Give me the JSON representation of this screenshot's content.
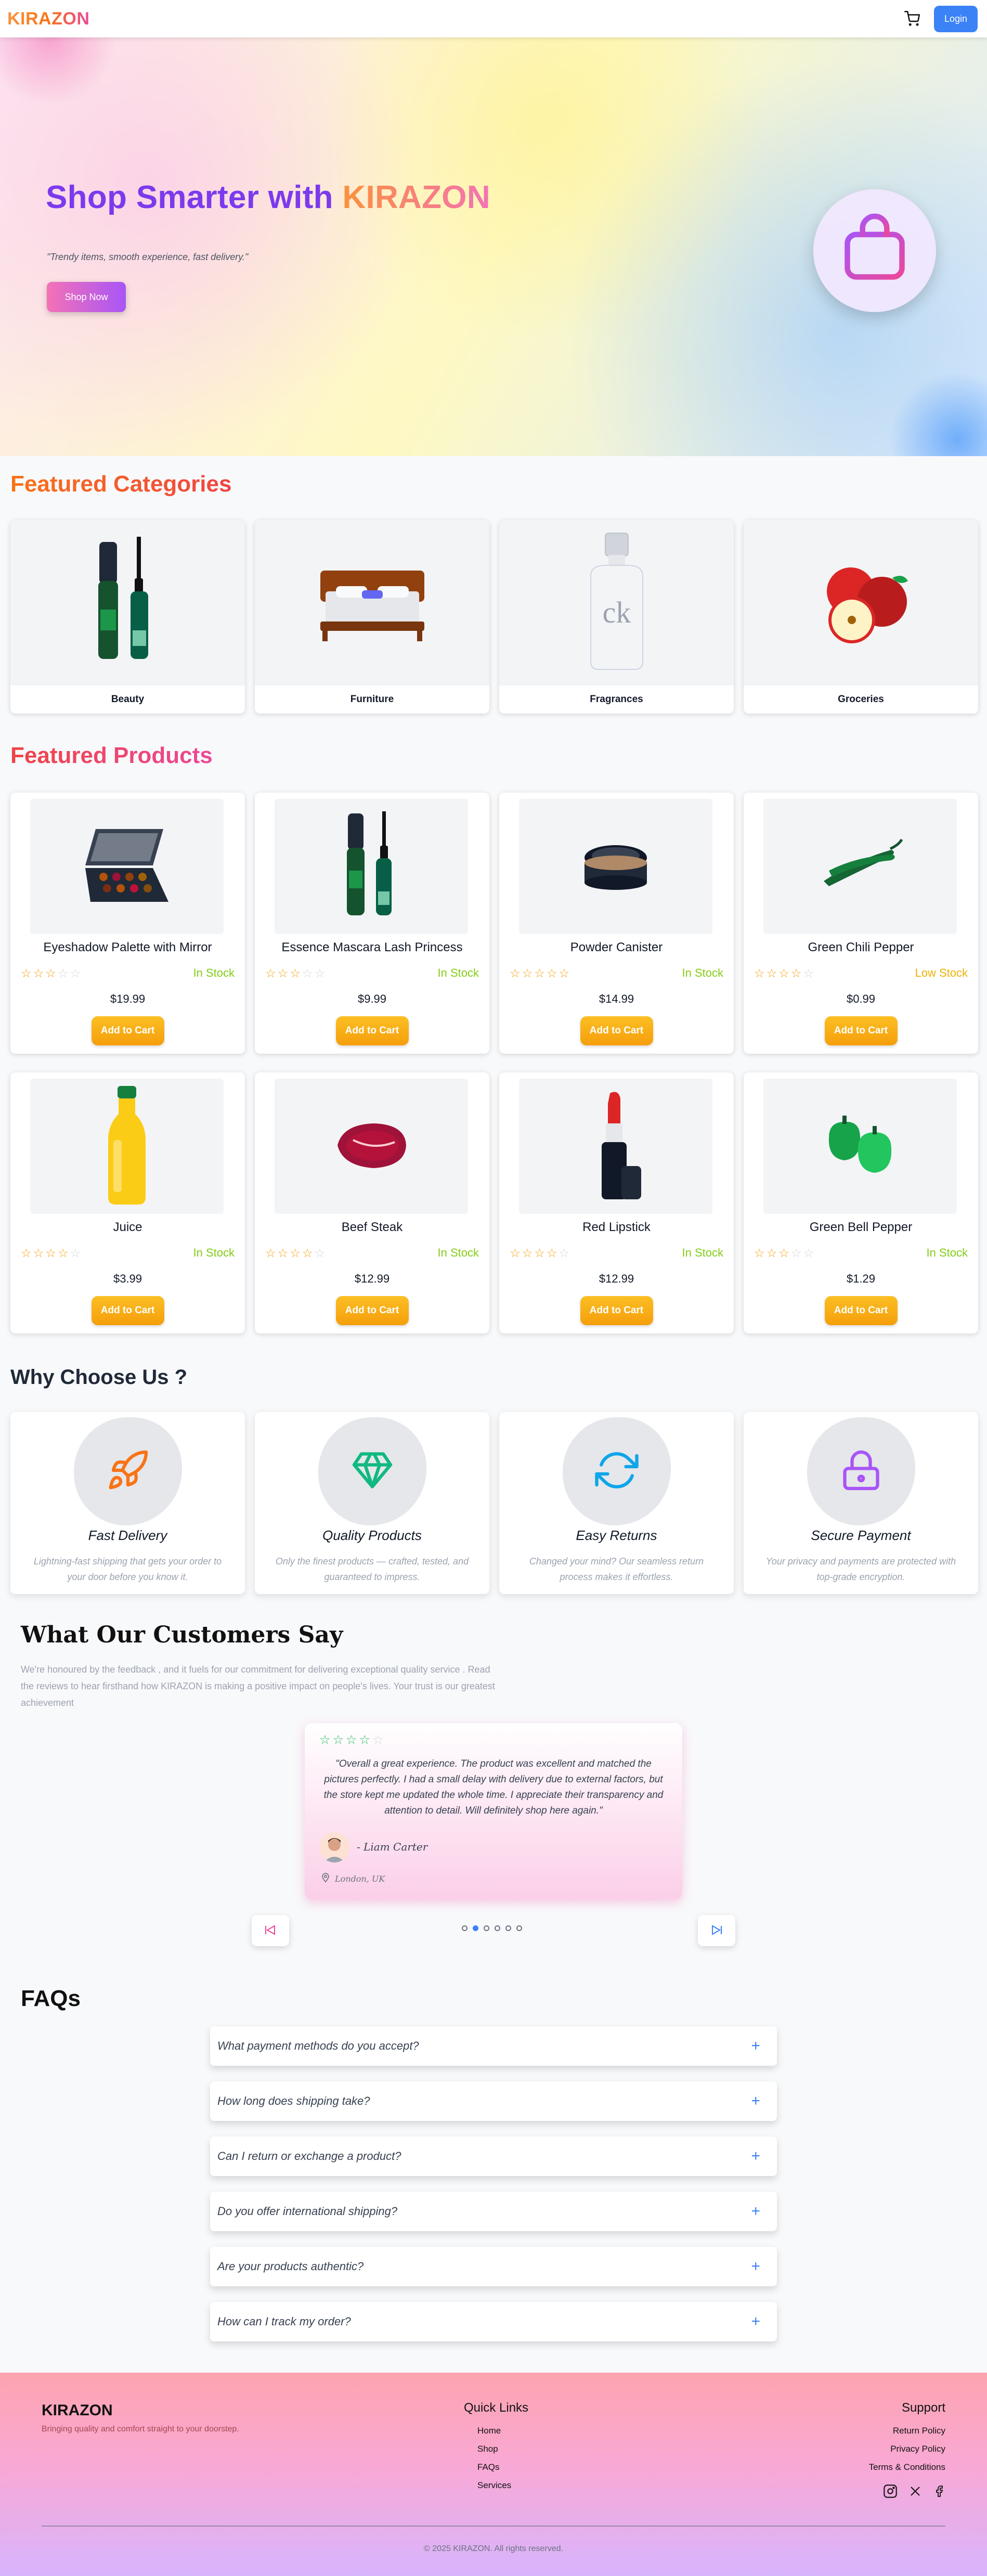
{
  "nav": {
    "logo": "KIRAZON",
    "login_label": "Login"
  },
  "hero": {
    "title_prefix": "Shop Smarter with ",
    "title_brand": "KIRAZON",
    "subtitle": "\"Trendy items, smooth experience, fast delivery.\"",
    "cta_label": "Shop Now"
  },
  "categories": {
    "title": "Featured Categories",
    "items": [
      {
        "label": "Beauty",
        "icon": "mascara-icon"
      },
      {
        "label": "Furniture",
        "icon": "bed-icon"
      },
      {
        "label": "Fragrances",
        "icon": "perfume-bottle-icon"
      },
      {
        "label": "Groceries",
        "icon": "apples-icon"
      }
    ]
  },
  "products": {
    "title": "Featured Products",
    "add_label": "Add to Cart",
    "items": [
      {
        "name": "Eyeshadow Palette with Mirror",
        "rating": 3,
        "stock": "In Stock",
        "price": "$19.99",
        "icon": "eyeshadow-palette-icon"
      },
      {
        "name": "Essence Mascara Lash Princess",
        "rating": 3,
        "stock": "In Stock",
        "price": "$9.99",
        "icon": "mascara-icon"
      },
      {
        "name": "Powder Canister",
        "rating": 5,
        "stock": "In Stock",
        "price": "$14.99",
        "icon": "powder-canister-icon"
      },
      {
        "name": "Green Chili Pepper",
        "rating": 4,
        "stock": "Low Stock",
        "price": "$0.99",
        "icon": "chili-pepper-icon"
      },
      {
        "name": "Juice",
        "rating": 4,
        "stock": "In Stock",
        "price": "$3.99",
        "icon": "juice-bottle-icon"
      },
      {
        "name": "Beef Steak",
        "rating": 4,
        "stock": "In Stock",
        "price": "$12.99",
        "icon": "steak-icon"
      },
      {
        "name": "Red Lipstick",
        "rating": 4,
        "stock": "In Stock",
        "price": "$12.99",
        "icon": "lipstick-icon"
      },
      {
        "name": "Green Bell Pepper",
        "rating": 3,
        "stock": "In Stock",
        "price": "$1.29",
        "icon": "bell-pepper-icon"
      }
    ]
  },
  "why": {
    "title": "Why Choose Us ?",
    "items": [
      {
        "name": "Fast Delivery",
        "desc": "Lightning-fast shipping that gets your order to your door before you know it.",
        "icon": "rocket-icon",
        "color": "#f97316"
      },
      {
        "name": "Quality Products",
        "desc": "Only the finest products — crafted, tested, and guaranteed to impress.",
        "icon": "gem-icon",
        "color": "#10b981"
      },
      {
        "name": "Easy Returns",
        "desc": "Changed your mind? Our seamless return process makes it effortless.",
        "icon": "refresh-icon",
        "color": "#0ea5e9"
      },
      {
        "name": "Secure Payment",
        "desc": "Your privacy and payments are protected with top-grade encryption.",
        "icon": "lock-icon",
        "color": "#a855f7"
      }
    ]
  },
  "testimonials": {
    "title": "What Our Customers Say",
    "intro": "We're honoured by the feedback , and it fuels for our commitment for delivering exceptional quality service . Read the reviews to hear firsthand how KIRAZON is making a positive impact on people's lives. Your trust is our greatest achievement",
    "rating": 4,
    "quote": "\"Overall a great experience. The product was excellent and matched the pictures perfectly. I had a small delay with delivery due to external factors, but the store kept me updated the whole time. I appreciate their transparency and attention to detail. Will definitely shop here again.\"",
    "author": "- Liam Carter",
    "location": "London, UK",
    "active_slide": 2,
    "slide_count": 6
  },
  "faq": {
    "title": "FAQs",
    "items": [
      "What payment methods do you accept?",
      "How long does shipping take?",
      "Can I return or exchange a product?",
      "Do you offer international shipping?",
      "Are your products authentic?",
      "How can I track my order?"
    ]
  },
  "footer": {
    "brand": "KIRAZON",
    "tagline": "Bringing quality and comfort straight to your doorstep.",
    "quick_links_title": "Quick Links",
    "quick_links": [
      "Home",
      "Shop",
      "FAQs",
      "Services"
    ],
    "support_title": "Support",
    "support_links": [
      "Return Policy",
      "Privacy Policy",
      "Terms & Conditions"
    ],
    "copyright": "© 2025 KIRAZON. All rights reserved."
  }
}
